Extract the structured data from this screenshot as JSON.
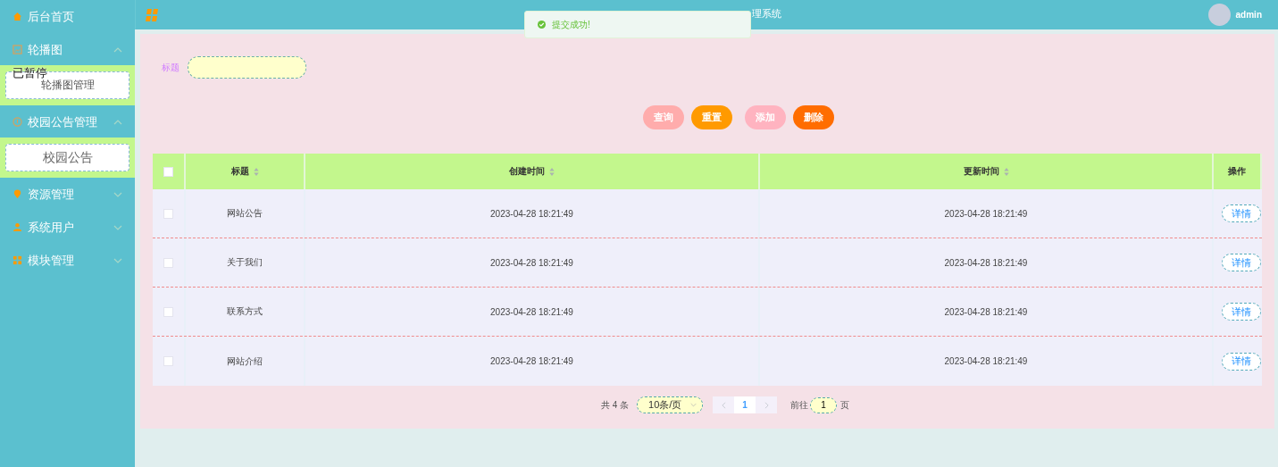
{
  "sidebar": {
    "overlay_text": "已暂停",
    "items": [
      {
        "label": "后台首页",
        "kind": "link"
      },
      {
        "label": "轮播图",
        "kind": "menu",
        "expanded": true,
        "children": [
          {
            "label": "轮播图管理"
          }
        ]
      },
      {
        "label": "校园公告管理",
        "kind": "menu",
        "expanded": true,
        "children": [
          {
            "label": "校园公告"
          }
        ]
      },
      {
        "label": "资源管理",
        "kind": "menu",
        "expanded": false
      },
      {
        "label": "系统用户",
        "kind": "menu",
        "expanded": false
      },
      {
        "label": "模块管理",
        "kind": "menu",
        "expanded": false
      }
    ]
  },
  "header": {
    "title": "理系统",
    "user": "admin"
  },
  "toast": {
    "message": "提交成功!"
  },
  "search": {
    "label": "标题"
  },
  "buttons": [
    {
      "label": "查询",
      "color": "#ffacac"
    },
    {
      "label": "重置",
      "color": "#ff9a00"
    },
    {
      "label": "添加",
      "color": "#ffb3c0"
    },
    {
      "label": "删除",
      "color": "#ff6d00"
    }
  ],
  "table": {
    "columns": [
      "标题",
      "创建时间",
      "更新时间",
      "操作"
    ],
    "select_all": false,
    "rows": [
      {
        "checked": false,
        "title": "网站公告",
        "created": "2023-04-28 18:21:49",
        "updated": "2023-04-28 18:21:49",
        "action": "详情"
      },
      {
        "checked": false,
        "title": "关于我们",
        "created": "2023-04-28 18:21:49",
        "updated": "2023-04-28 18:21:49",
        "action": "详情"
      },
      {
        "checked": false,
        "title": "联系方式",
        "created": "2023-04-28 18:21:49",
        "updated": "2023-04-28 18:21:49",
        "action": "详情"
      },
      {
        "checked": false,
        "title": "网站介绍",
        "created": "2023-04-28 18:21:49",
        "updated": "2023-04-28 18:21:49",
        "action": "详情"
      }
    ]
  },
  "pagination": {
    "total": "共 4 条",
    "page_size": "10条/页",
    "pages": [
      {
        "label": "1",
        "selected": true
      }
    ],
    "goto_label": "前往",
    "goto_value": "1",
    "goto_suffix": "页"
  }
}
